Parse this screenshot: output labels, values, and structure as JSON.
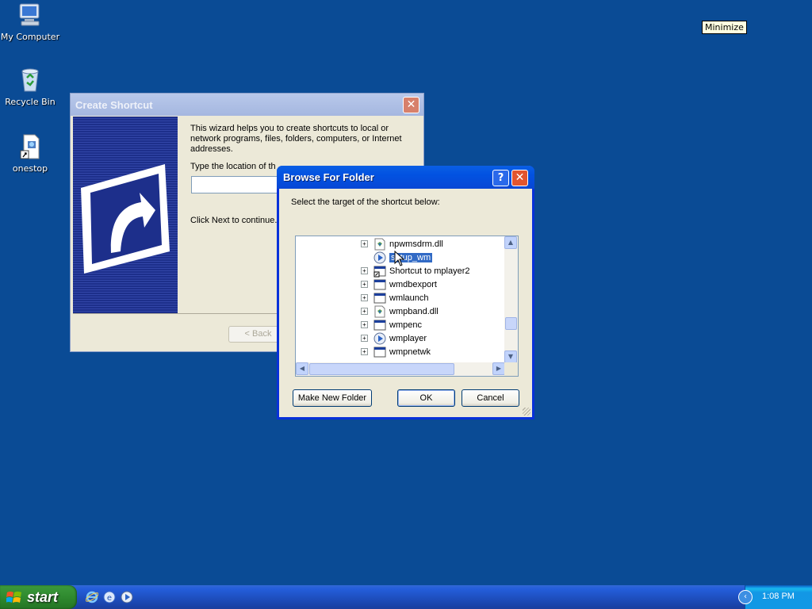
{
  "desktop": {
    "icons": [
      {
        "label": "My Computer"
      },
      {
        "label": "Recycle Bin"
      },
      {
        "label": "onestop"
      }
    ]
  },
  "tooltip": {
    "text": "Minimize"
  },
  "create_shortcut": {
    "title": "Create Shortcut",
    "description": "This wizard helps you to create shortcuts to local or network programs, files, folders, computers, or Internet addresses.",
    "location_label": "Type the location of th",
    "location_value": "",
    "next_hint": "Click Next to continue.",
    "back_label": "< Back"
  },
  "browse_dialog": {
    "title": "Browse For Folder",
    "prompt": "Select the target of the shortcut below:",
    "tree_items": [
      {
        "label": "npwmsdrm.dll",
        "icon": "dll-icon",
        "expander": "+"
      },
      {
        "label": "setup_wm",
        "icon": "media-player-icon",
        "expander": "",
        "selected": true
      },
      {
        "label": "Shortcut to mplayer2",
        "icon": "shortcut-icon",
        "expander": "+"
      },
      {
        "label": "wmdbexport",
        "icon": "window-app-icon",
        "expander": "+"
      },
      {
        "label": "wmlaunch",
        "icon": "window-app-icon",
        "expander": "+"
      },
      {
        "label": "wmpband.dll",
        "icon": "dll-icon",
        "expander": "+"
      },
      {
        "label": "wmpenc",
        "icon": "window-app-icon",
        "expander": "+"
      },
      {
        "label": "wmplayer",
        "icon": "media-player-icon",
        "expander": "+"
      },
      {
        "label": "wmpnetwk",
        "icon": "window-app-icon",
        "expander": "+"
      }
    ],
    "make_new_folder_label": "Make New Folder",
    "ok_label": "OK",
    "cancel_label": "Cancel",
    "help_label": "?",
    "close_label": "✕"
  },
  "taskbar": {
    "start_label": "start",
    "quick_launch": [
      "internet-explorer-icon",
      "outlook-express-icon",
      "media-player-icon"
    ],
    "clock": "1:08 PM",
    "tray_arrow": "‹"
  },
  "colors": {
    "desktop": "#0a4b95",
    "titlebar_active": "#0252e1",
    "selection": "#316ac5",
    "start_green": "#2f8a2f"
  }
}
